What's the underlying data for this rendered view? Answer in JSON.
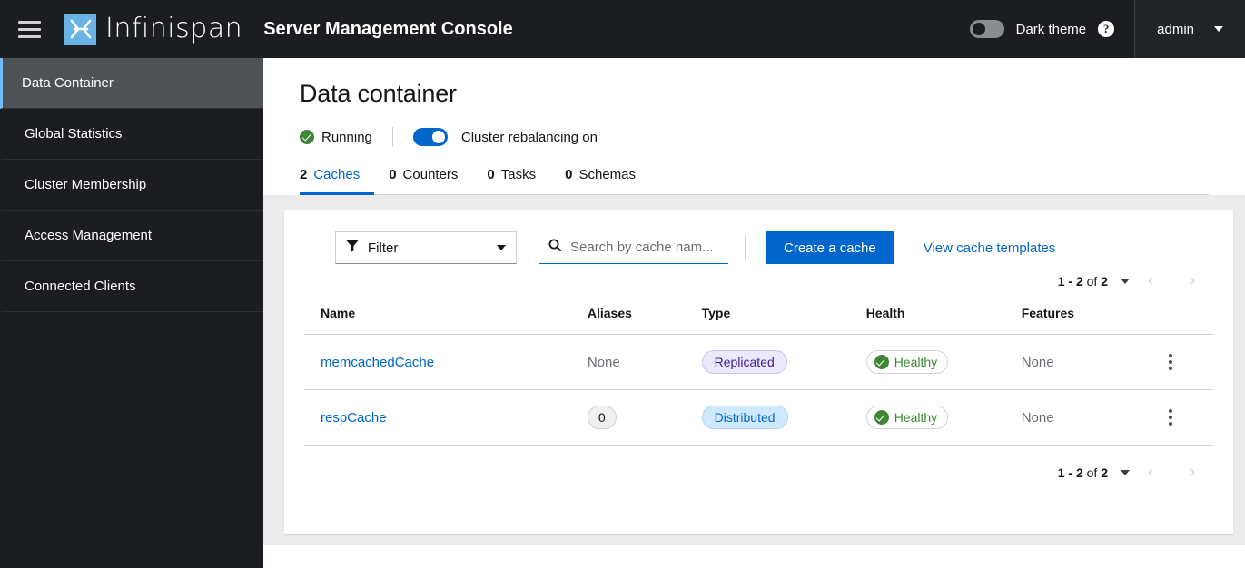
{
  "masthead": {
    "menu_icon": "hamburger-icon",
    "brand_name": "Infinispan",
    "logo_icon": "infinispan-logo-icon",
    "console_title": "Server Management Console",
    "theme_toggle_label": "Dark theme",
    "theme_toggle_state": "off",
    "help_icon": "help-circle-icon",
    "user_name": "admin",
    "user_caret_icon": "caret-down-icon"
  },
  "sidebar": {
    "items": [
      {
        "label": "Data Container",
        "active": true
      },
      {
        "label": "Global Statistics",
        "active": false
      },
      {
        "label": "Cluster Membership",
        "active": false
      },
      {
        "label": "Access Management",
        "active": false
      },
      {
        "label": "Connected Clients",
        "active": false
      }
    ]
  },
  "page": {
    "title": "Data container",
    "status_icon": "check-circle-icon",
    "status_text": "Running",
    "rebalancing_toggle_state": "on",
    "rebalancing_label": "Cluster rebalancing on"
  },
  "tabs": [
    {
      "count": "2",
      "label": "Caches",
      "active": true
    },
    {
      "count": "0",
      "label": "Counters",
      "active": false
    },
    {
      "count": "0",
      "label": "Tasks",
      "active": false
    },
    {
      "count": "0",
      "label": "Schemas",
      "active": false
    }
  ],
  "toolbar": {
    "filter_icon": "funnel-icon",
    "filter_label": "Filter",
    "filter_caret_icon": "caret-down-icon",
    "search_icon": "search-icon",
    "search_placeholder": "Search by cache nam...",
    "search_value": "",
    "create_cache_label": "Create a cache",
    "view_templates_label": "View cache templates"
  },
  "pagination_top": {
    "range": "1 - 2",
    "of": "of",
    "total": "2",
    "caret_icon": "caret-down-icon",
    "prev_icon": "chevron-left-icon",
    "next_icon": "chevron-right-icon"
  },
  "pagination_bottom": {
    "range": "1 - 2",
    "of": "of",
    "total": "2",
    "caret_icon": "caret-down-icon",
    "prev_icon": "chevron-left-icon",
    "next_icon": "chevron-right-icon"
  },
  "table": {
    "headers": [
      "Name",
      "Aliases",
      "Type",
      "Health",
      "Features"
    ],
    "rows": [
      {
        "name": "memcachedCache",
        "aliases": "None",
        "aliases_is_badge": false,
        "type": "Replicated",
        "type_style": "replicated",
        "health": "Healthy",
        "health_icon": "check-circle-icon",
        "features": "None",
        "actions_icon": "kebab-menu-icon"
      },
      {
        "name": "respCache",
        "aliases": "0",
        "aliases_is_badge": true,
        "type": "Distributed",
        "type_style": "distributed",
        "health": "Healthy",
        "health_icon": "check-circle-icon",
        "features": "None",
        "actions_icon": "kebab-menu-icon"
      }
    ]
  },
  "colors": {
    "masthead_bg": "#1b1d21",
    "sidebar_bg": "#1b1d21",
    "sidebar_active_bg": "#4f5255",
    "sidebar_active_accent": "#73bcf7",
    "brand_logo_bg": "#6ab3e5",
    "primary_blue": "#0066cc",
    "link_blue": "#0066cc",
    "success_green": "#3e8635",
    "content_bg": "#ececec",
    "replicated_badge_bg": "#ece9fc",
    "replicated_badge_text": "#40199a",
    "distributed_badge_bg": "#cfe9ff",
    "distributed_badge_text": "#0066cc"
  }
}
